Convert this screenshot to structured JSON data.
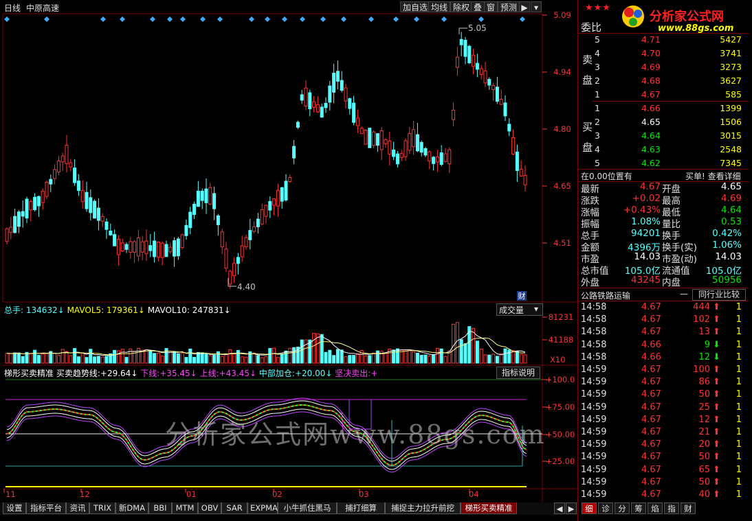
{
  "toolbar": {
    "period": "日线",
    "stock_name": "中原高速",
    "add_favorite": "加自选",
    "avg_line": "均线",
    "adjust": "除权",
    "overlay": "叠",
    "window": "窗",
    "forecast": "预测"
  },
  "brand": {
    "logo_text": "分析家公式网",
    "logo_url": "www.88gs.com",
    "stars": "★★★"
  },
  "price_chart": {
    "y_labels": [
      "5.09",
      "4.94",
      "4.80",
      "4.65",
      "4.51"
    ],
    "high_marker": "5.05",
    "low_marker": "4.40",
    "fin_badge": "财"
  },
  "volume_panel": {
    "label": "总手:",
    "total": "134632",
    "mavol5_label": "MAVOL5:",
    "mavol5": "179361",
    "mavol10_label": "MAVOL10:",
    "mavol10": "247831",
    "arrow": "↓",
    "dropdown": "成交量",
    "y_labels": [
      "81231",
      "41188",
      "X10"
    ]
  },
  "indicator_panel": {
    "name": "梯形买卖精准",
    "trend_label": "买卖趋势线:",
    "trend_value": "+29.64",
    "lower_label": "下线:",
    "lower_value": "+35.45",
    "upper_label": "上线:",
    "upper_value": "+43.45",
    "mid_label": "中部加仓:",
    "mid_value": "+20.00",
    "sell_label": "坚决卖出:",
    "sell_value": "+",
    "arrow": "↓",
    "help_button": "指标说明",
    "y_labels": [
      "+100.0",
      "+75.00",
      "+50.00",
      "+25.00"
    ]
  },
  "x_axis": [
    "11",
    "12",
    "01",
    "02",
    "03",
    "04"
  ],
  "watermark": "分析家公式网www.88gs.com",
  "order_book": {
    "title": "委比",
    "sell_label": [
      "卖",
      "盘"
    ],
    "buy_label": [
      "买",
      "盘"
    ],
    "asks": [
      {
        "level": "5",
        "price": "4.71",
        "vol": "5427"
      },
      {
        "level": "4",
        "price": "4.70",
        "vol": "3741"
      },
      {
        "level": "3",
        "price": "4.69",
        "vol": "3273"
      },
      {
        "level": "2",
        "price": "4.68",
        "vol": "3627"
      },
      {
        "level": "1",
        "price": "4.67",
        "vol": "585"
      }
    ],
    "bids": [
      {
        "level": "1",
        "price": "4.66",
        "vol": "1399",
        "color": "red"
      },
      {
        "level": "2",
        "price": "4.65",
        "vol": "1506",
        "color": "white"
      },
      {
        "level": "3",
        "price": "4.64",
        "vol": "3015",
        "color": "green"
      },
      {
        "level": "4",
        "price": "4.63",
        "vol": "2548",
        "color": "green"
      },
      {
        "level": "5",
        "price": "4.62",
        "vol": "7345",
        "color": "green"
      }
    ],
    "position_text": "在0.00位置有",
    "detail_link": "买单! 查看详细"
  },
  "quote": [
    {
      "l1": "最新",
      "v1": "4.67",
      "c1": "red",
      "l2": "开盘",
      "v2": "4.65",
      "c2": "white"
    },
    {
      "l1": "涨跌",
      "v1": "+0.02",
      "c1": "red",
      "l2": "最高",
      "v2": "4.69",
      "c2": "red"
    },
    {
      "l1": "涨幅",
      "v1": "+0.43%",
      "c1": "red",
      "l2": "最低",
      "v2": "4.64",
      "c2": "green"
    },
    {
      "l1": "振幅",
      "v1": "1.08%",
      "c1": "cyan",
      "l2": "量比",
      "v2": "0.53",
      "c2": "green"
    },
    {
      "l1": "总手",
      "v1": "94201",
      "c1": "cyan",
      "l2": "换手",
      "v2": "0.42%",
      "c2": "cyan"
    },
    {
      "l1": "金额",
      "v1": "4396万",
      "c1": "cyan",
      "l2": "换手(实)",
      "v2": "1.06%",
      "c2": "cyan"
    },
    {
      "l1": "市盈",
      "v1": "14.03",
      "c1": "white",
      "l2": "市盈(动)",
      "v2": "14.03",
      "c2": "white"
    },
    {
      "l1": "总市值",
      "v1": "105.0亿",
      "c1": "cyan",
      "l2": "流通值",
      "v2": "105.0亿",
      "c2": "cyan"
    },
    {
      "l1": "外盘",
      "v1": "43245",
      "c1": "red",
      "l2": "内盘",
      "v2": "50956",
      "c2": "green"
    }
  ],
  "industry": {
    "name": "公路铁路运输",
    "dash": "—",
    "compare_button": "同行业比较"
  },
  "ticks": [
    {
      "time": "14:58",
      "price": "4.67",
      "vol": "444",
      "dir": "up",
      "n": "1"
    },
    {
      "time": "14:58",
      "price": "4.67",
      "vol": "102",
      "dir": "up",
      "n": "1"
    },
    {
      "time": "14:58",
      "price": "4.67",
      "vol": "13",
      "dir": "up",
      "n": "1"
    },
    {
      "time": "14:58",
      "price": "4.66",
      "vol": "9",
      "dir": "down",
      "n": "1"
    },
    {
      "time": "14:58",
      "price": "4.66",
      "vol": "12",
      "dir": "down",
      "n": "1"
    },
    {
      "time": "14:59",
      "price": "4.67",
      "vol": "100",
      "dir": "up",
      "n": "1"
    },
    {
      "time": "14:59",
      "price": "4.67",
      "vol": "86",
      "dir": "up",
      "n": "1"
    },
    {
      "time": "14:59",
      "price": "4.67",
      "vol": "50",
      "dir": "up",
      "n": "1"
    },
    {
      "time": "14:59",
      "price": "4.67",
      "vol": "25",
      "dir": "up",
      "n": "1"
    },
    {
      "time": "14:59",
      "price": "4.67",
      "vol": "12",
      "dir": "up",
      "n": "1"
    },
    {
      "time": "14:59",
      "price": "4.67",
      "vol": "21",
      "dir": "up",
      "n": "1"
    },
    {
      "time": "14:59",
      "price": "4.67",
      "vol": "20",
      "dir": "up",
      "n": "1"
    },
    {
      "time": "14:59",
      "price": "4.67",
      "vol": "50",
      "dir": "up",
      "n": "1"
    },
    {
      "time": "14:59",
      "price": "4.67",
      "vol": "65",
      "dir": "up",
      "n": "1"
    },
    {
      "time": "14:59",
      "price": "4.67",
      "vol": "50",
      "dir": "up",
      "n": "1"
    },
    {
      "time": "14:59",
      "price": "4.67",
      "vol": "40",
      "dir": "up",
      "n": "1"
    }
  ],
  "bottom_tabs": [
    "设置",
    "指标平台",
    "资讯",
    "TRIX",
    "新DMA",
    "BBI",
    "MTM",
    "OBV",
    "SAR",
    "EXPMA",
    "小牛抓住黑马",
    "捕打细算",
    "捕捉主力拉升前挖",
    "梯形买卖精准"
  ],
  "right_tabs": [
    "细",
    "诊",
    "分",
    "筹",
    "焰",
    "指",
    "财"
  ],
  "colors": {
    "up": "#ff3232",
    "down": "#55ffff",
    "ma5": "#ffffff",
    "ma10": "#ffff80",
    "trend": "#ff40ff",
    "frame": "#7a0000"
  }
}
